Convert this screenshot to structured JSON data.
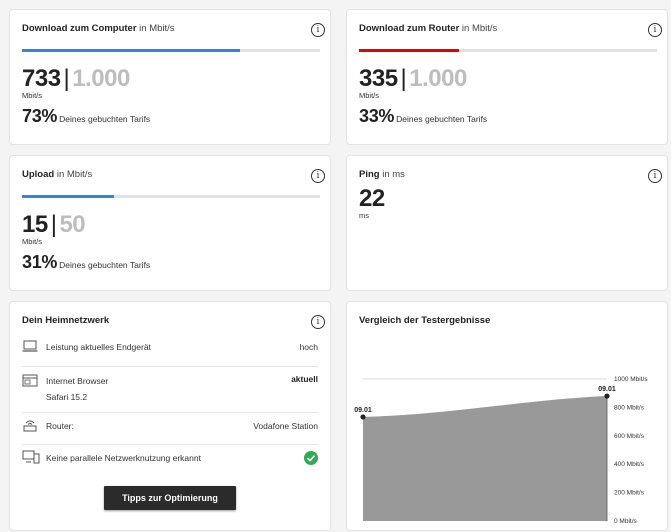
{
  "download_computer": {
    "title": "Download zum Computer",
    "unit": "in Mbit/s",
    "value": "733",
    "max": "1.000",
    "value_unit": "Mbit/s",
    "percent": "73%",
    "percent_text": "Deines gebuchten Tarifs",
    "fill_fraction": 0.733,
    "color": "#2e86de"
  },
  "download_router": {
    "title": "Download zum Router",
    "unit": "in Mbit/s",
    "value": "335",
    "max": "1.000",
    "value_unit": "Mbit/s",
    "percent": "33%",
    "percent_text": "Deines gebuchten Tarifs",
    "fill_fraction": 0.335,
    "color": "#e60000"
  },
  "upload": {
    "title": "Upload",
    "unit": "in Mbit/s",
    "value": "15",
    "max": "50",
    "value_unit": "Mbit/s",
    "percent": "31%",
    "percent_text": "Deines gebuchten Tarifs",
    "fill_fraction": 0.31,
    "color": "#2e86de"
  },
  "ping": {
    "title": "Ping",
    "unit": "in ms",
    "value": "22",
    "value_unit": "ms"
  },
  "heimnetz": {
    "title": "Dein Heimnetzwerk",
    "rows": [
      {
        "icon": "laptop-icon",
        "label": "Leistung aktuelles Endgerät",
        "value": "hoch"
      },
      {
        "icon": "browser-icon",
        "label": "Internet Browser",
        "sublabel": "Safari 15.2",
        "value": "aktuell"
      },
      {
        "icon": "router-icon",
        "label": "Router:",
        "value": "Vodafone Station"
      },
      {
        "icon": "devices-icon",
        "label": "Keine parallele Netzwerknutzung erkannt",
        "value_icon": "check-circle-icon"
      }
    ],
    "button_label": "Tipps zur Optimierung",
    "check_color": "#34a853"
  },
  "vergleich": {
    "title": "Vergleich der Testergebnisse"
  },
  "chart_data": {
    "type": "area",
    "x": [
      "09.01",
      "09.01"
    ],
    "values": [
      733,
      880
    ],
    "y_tick_labels": [
      "1000 Mbit/s",
      "800 Mbit/s",
      "600 Mbit/s",
      "400 Mbit/s",
      "200 Mbit/s",
      "0 Mbit/s"
    ],
    "y_ticks": [
      1000,
      800,
      600,
      400,
      200,
      0
    ],
    "ylim": [
      0,
      1000
    ],
    "fill_color": "#999999",
    "grid": true
  }
}
